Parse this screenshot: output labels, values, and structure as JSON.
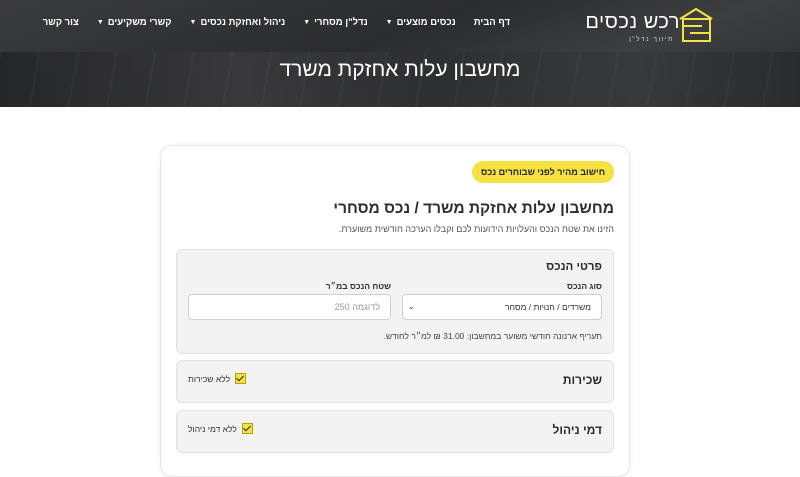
{
  "header": {
    "logo": {
      "name": "רכש נכסים",
      "tagline": "תיווך נדל\"ן"
    },
    "nav": [
      {
        "label": "דף הבית",
        "has_dropdown": false
      },
      {
        "label": "נכסים מוצעים",
        "has_dropdown": true
      },
      {
        "label": "נדל\"ן מסחרי",
        "has_dropdown": true
      },
      {
        "label": "ניהול ואחזקת נכסים",
        "has_dropdown": true
      },
      {
        "label": "קשרי משקיעים",
        "has_dropdown": true
      },
      {
        "label": "צור קשר",
        "has_dropdown": false
      }
    ],
    "page_title": "מחשבון עלות אחזקת משרד",
    "colors": {
      "accent": "#f5e140",
      "header_bg": "#333436"
    }
  },
  "calculator": {
    "badge": "חישוב מהיר לפני שבוחרים נכס",
    "title": "מחשבון עלות אחזקת משרד / נכס מסחרי",
    "description": "הזינו את שטח הנכס והעלויות הידועות לכם וקבלו הערכה חודשית משוערת.",
    "details": {
      "title": "פרטי הנכס",
      "type_label": "סוג הנכס",
      "type_value": "משרדים / חנויות / מסחר",
      "area_label": "שטח הנכס במ״ר",
      "area_placeholder": "לדוגמה 250",
      "rate_note": "תעריף ארנונה חודשי משוער במחשבון: 31.00 ₪ למ״ר לחודש."
    },
    "rent": {
      "title": "שכירות",
      "checkbox_label": "ללא שכירות",
      "checked": true
    },
    "management": {
      "title": "דמי ניהול",
      "checkbox_label": "ללא דמי ניהול",
      "checked": true
    }
  }
}
